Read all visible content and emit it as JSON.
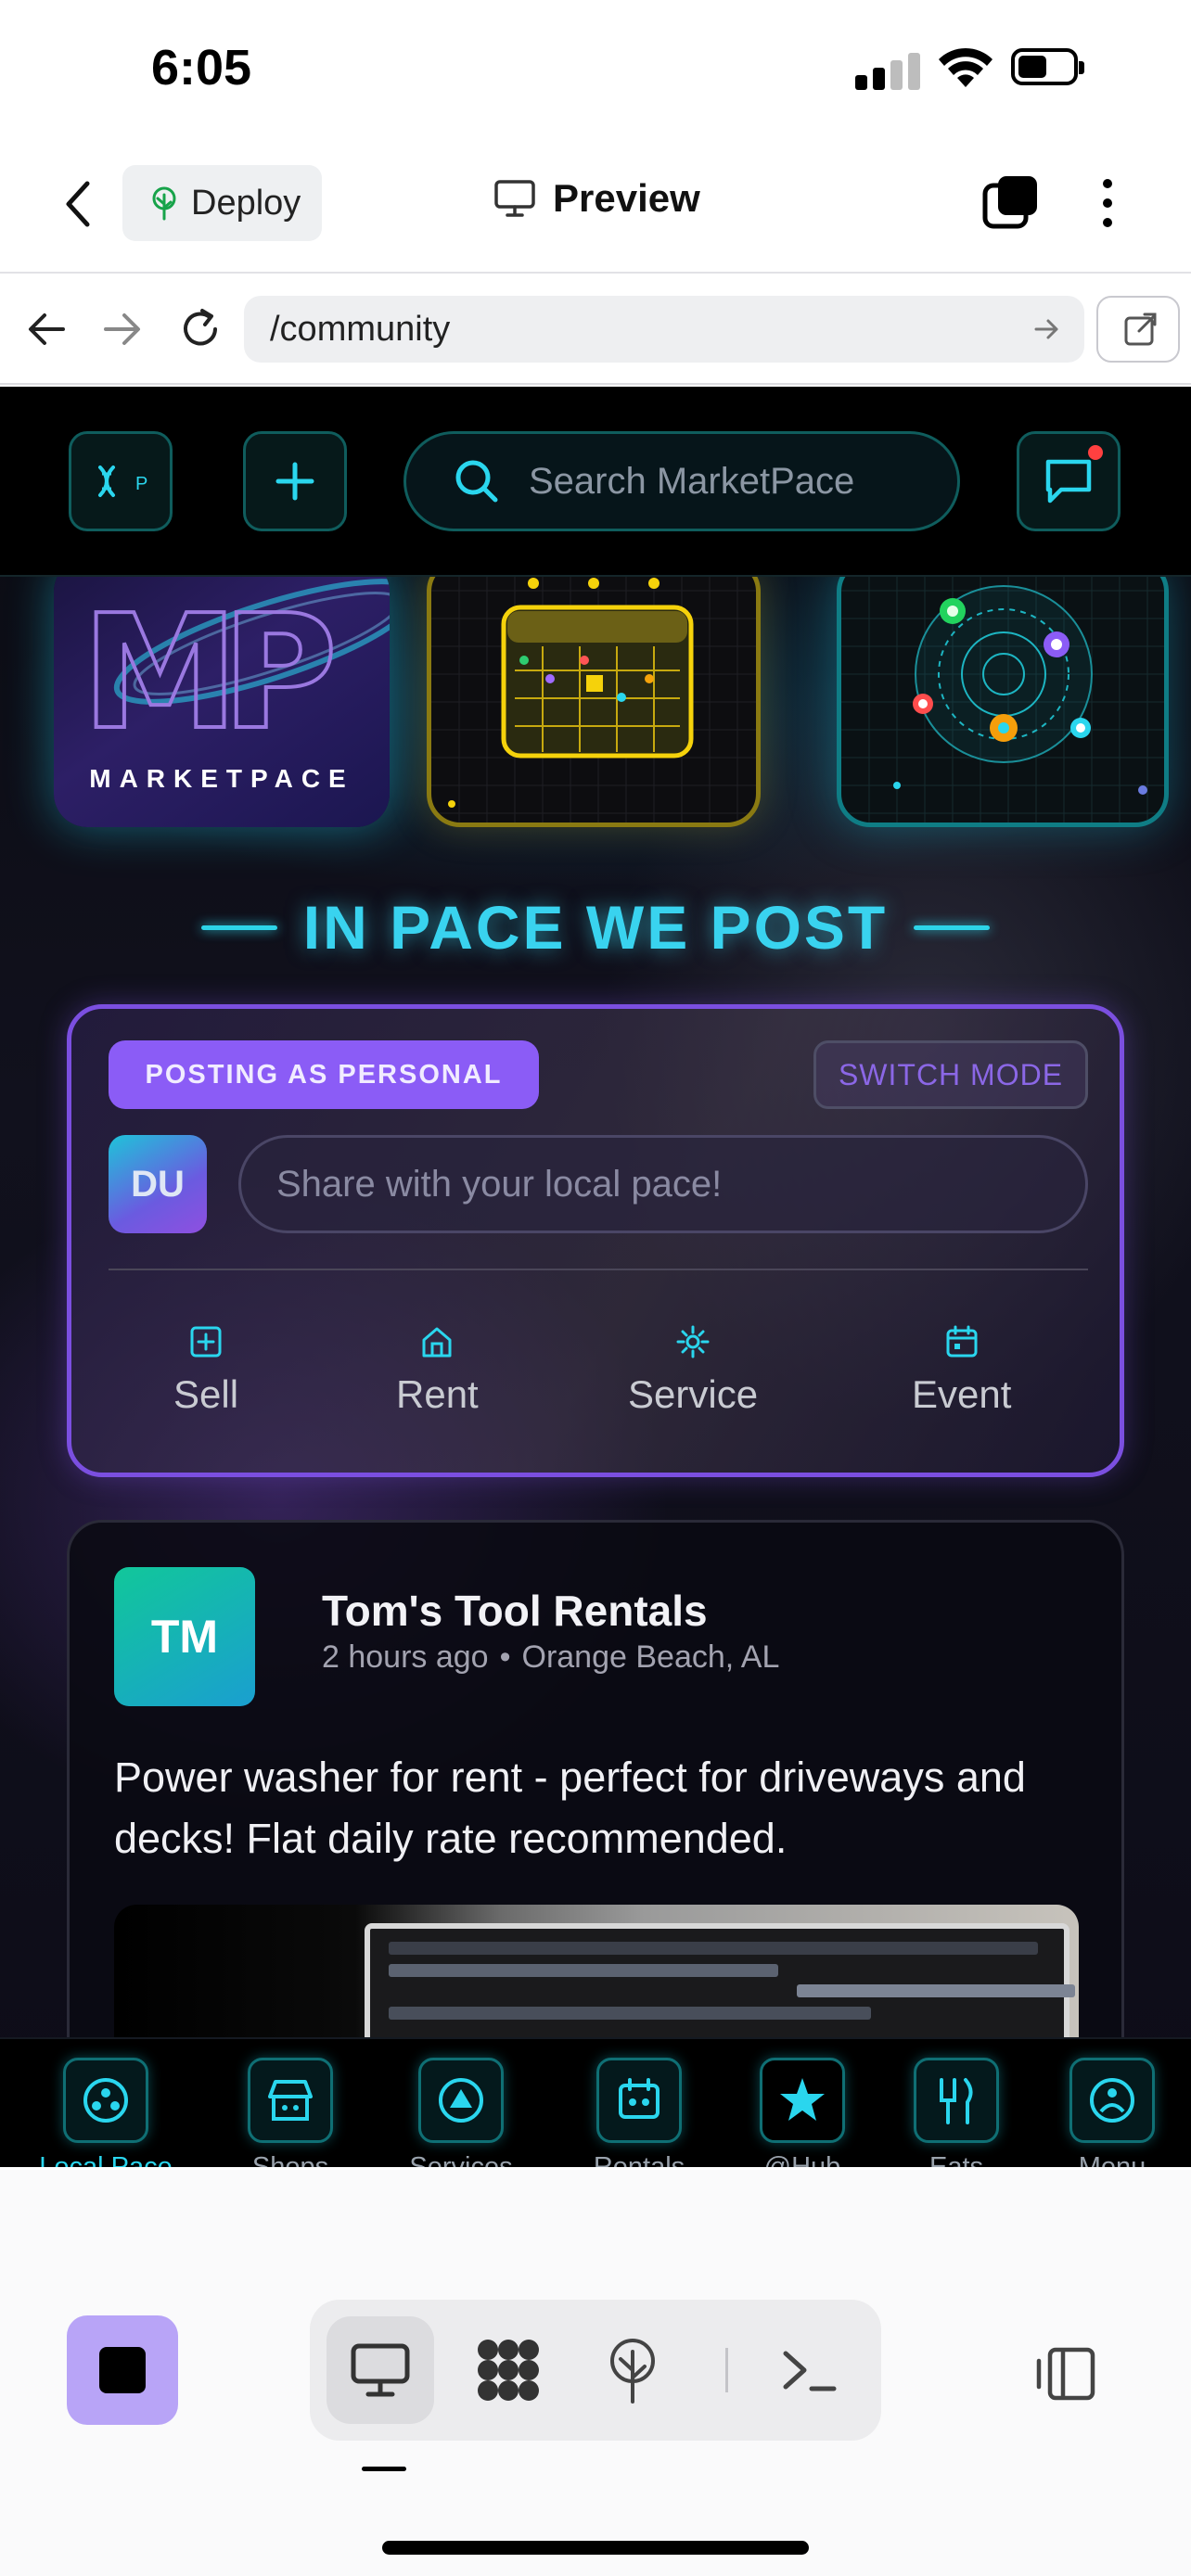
{
  "status_bar": {
    "time": "6:05"
  },
  "app_header": {
    "deploy_label": "Deploy",
    "preview_label": "Preview"
  },
  "browser": {
    "url": "/community"
  },
  "app": {
    "search_placeholder": "Search MarketPace",
    "logo_wordmark": "MARKETPACE",
    "tagline": "IN PACE WE POST",
    "composer": {
      "mode_badge": "POSTING AS PERSONAL",
      "switch_mode": "SWITCH MODE",
      "avatar_initials": "DU",
      "share_placeholder": "Share with your local pace!",
      "actions": [
        {
          "label": "Sell",
          "icon": "plus-square-icon"
        },
        {
          "label": "Rent",
          "icon": "home-icon"
        },
        {
          "label": "Service",
          "icon": "sun-icon"
        },
        {
          "label": "Event",
          "icon": "calendar-icon"
        }
      ]
    },
    "post": {
      "avatar_initials": "TM",
      "author": "Tom's Tool Rentals",
      "time": "2 hours ago",
      "separator": "•",
      "location": "Orange Beach, AL",
      "body": "Power washer for rent - perfect for driveways and decks! Flat daily rate recommended."
    },
    "bottom_tabs": [
      {
        "label": "Local Pace",
        "icon": "local-pace-icon",
        "active": true
      },
      {
        "label": "Shops",
        "icon": "shop-icon"
      },
      {
        "label": "Services",
        "icon": "services-icon"
      },
      {
        "label": "Rentals",
        "icon": "rentals-icon"
      },
      {
        "label": "@Hub",
        "icon": "star-icon"
      },
      {
        "label": "Eats",
        "icon": "utensils-icon"
      },
      {
        "label": "Menu",
        "icon": "menu-icon"
      }
    ]
  },
  "colors": {
    "accent_cyan": "#2ad6ee",
    "accent_purple": "#8b5cf6",
    "stop_button": "#b8a4f7"
  }
}
